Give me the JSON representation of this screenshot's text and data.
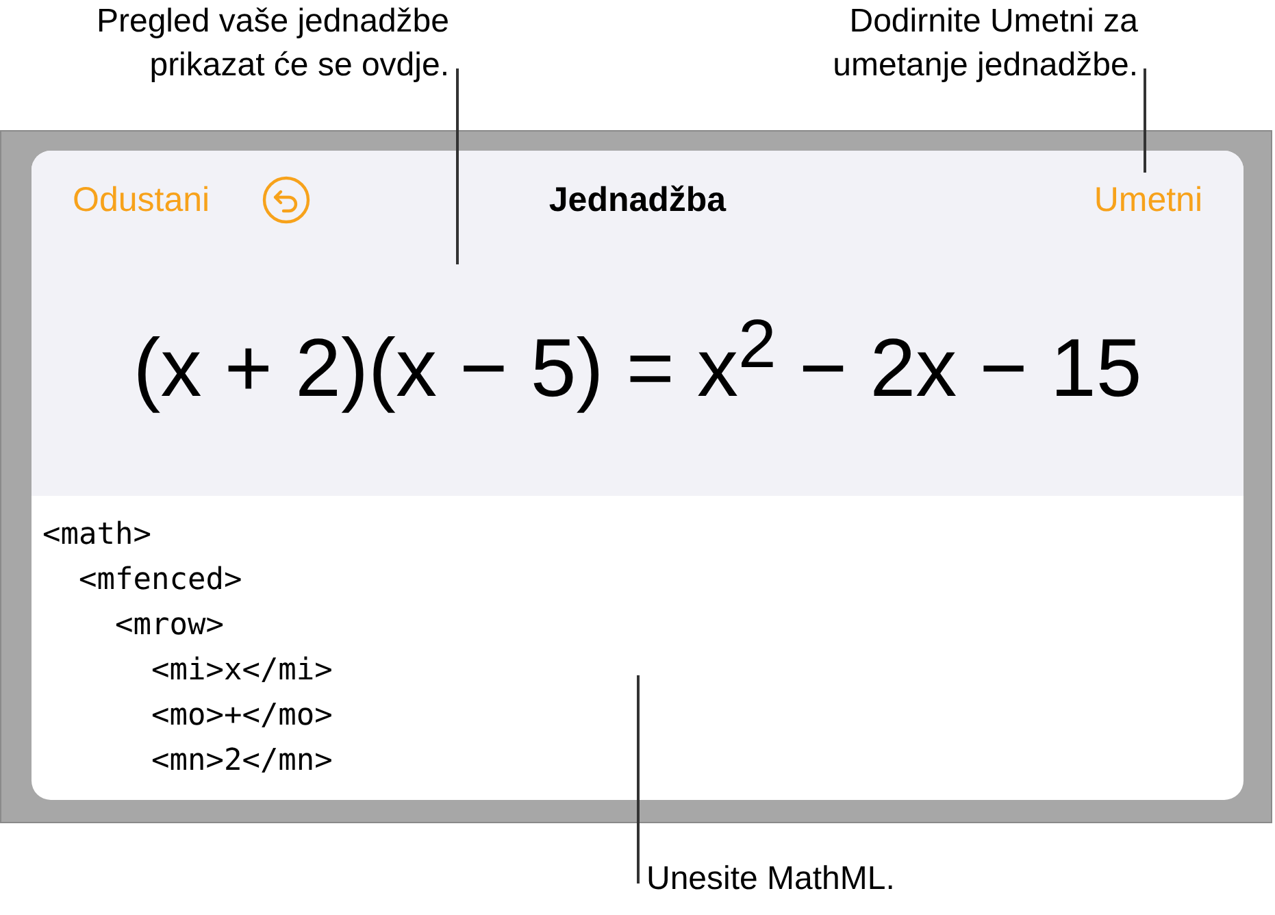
{
  "callouts": [
    {
      "kind": "top-left",
      "text": "Pregled vaše jednadžbe prikazat će se ovdje."
    },
    {
      "kind": "top-right",
      "text": "Dodirnite Umetni za umetanje jednadžbe."
    },
    {
      "kind": "bottom",
      "text": "Unesite MathML."
    }
  ],
  "dialog": {
    "cancel": "Odustani",
    "title": "Jednadžba",
    "insert": "Umetni",
    "preview": "(x + 2)(x − 5) = x$^{2}$ − 2x − 15",
    "code_lines": [
      "<math>",
      "  <mfenced>",
      "    <mrow>",
      "      <mi>x</mi>",
      "      <mo>+</mo>",
      "      <mn>2</mn>"
    ]
  }
}
